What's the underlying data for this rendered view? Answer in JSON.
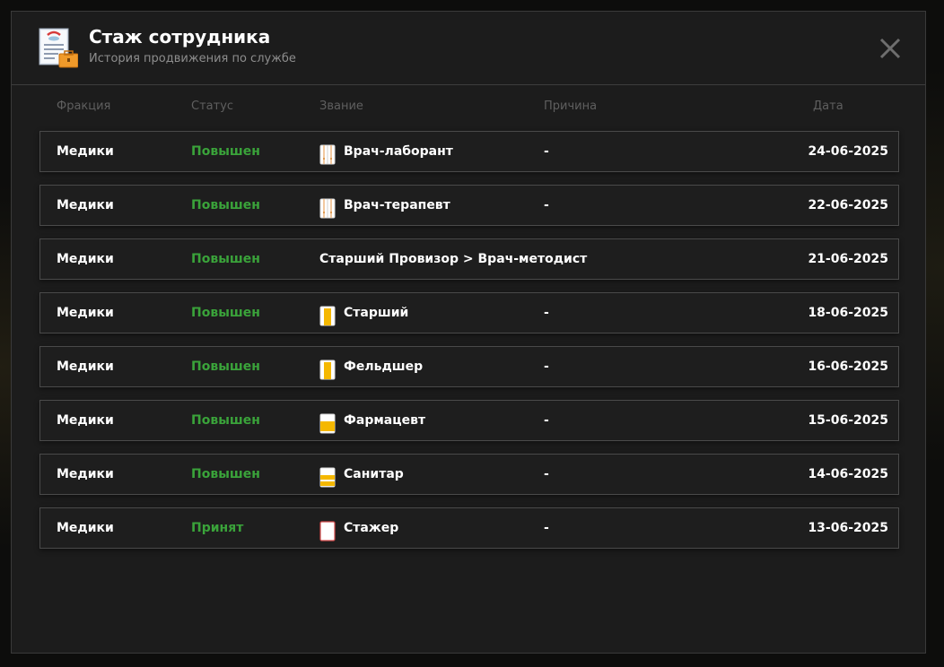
{
  "modal": {
    "title": "Стаж сотрудника",
    "subtitle": "История продвижения по службе",
    "header_icon": "service-record-document-icon",
    "close_icon": "close-icon"
  },
  "columns": {
    "faction": "Фракция",
    "status": "Статус",
    "rank": "Звание",
    "reason": "Причина",
    "date": "Дата"
  },
  "colors": {
    "status_green": "#3aa33a",
    "accent_yellow": "#f5b800",
    "panel_bg": "#1c1c1c"
  },
  "rows": [
    {
      "faction": "Медики",
      "status": "Повышен",
      "rank": "Врач-лаборант",
      "rank_icon": "white-coat-icon",
      "reason": "-",
      "date": "24-06-2025"
    },
    {
      "faction": "Медики",
      "status": "Повышен",
      "rank": "Врач-терапевт",
      "rank_icon": "white-coat-icon",
      "reason": "-",
      "date": "22-06-2025"
    },
    {
      "faction": "Медики",
      "status": "Повышен",
      "rank": "Старший Провизор > Врач-методист",
      "rank_icon": "",
      "reason": "",
      "date": "21-06-2025"
    },
    {
      "faction": "Медики",
      "status": "Повышен",
      "rank": "Старший",
      "rank_icon": "yellow-stripe-badge-icon",
      "reason": "-",
      "date": "18-06-2025"
    },
    {
      "faction": "Медики",
      "status": "Повышен",
      "rank": "Фельдшер",
      "rank_icon": "yellow-stripe-badge-icon",
      "reason": "-",
      "date": "16-06-2025"
    },
    {
      "faction": "Медики",
      "status": "Повышен",
      "rank": "Фармацевт",
      "rank_icon": "yellow-band-badge-icon",
      "reason": "-",
      "date": "15-06-2025"
    },
    {
      "faction": "Медики",
      "status": "Повышен",
      "rank": "Санитар",
      "rank_icon": "yellow-double-band-badge-icon",
      "reason": "-",
      "date": "14-06-2025"
    },
    {
      "faction": "Медики",
      "status": "Принят",
      "rank": "Стажер",
      "rank_icon": "white-red-outline-badge-icon",
      "reason": "-",
      "date": "13-06-2025"
    }
  ]
}
